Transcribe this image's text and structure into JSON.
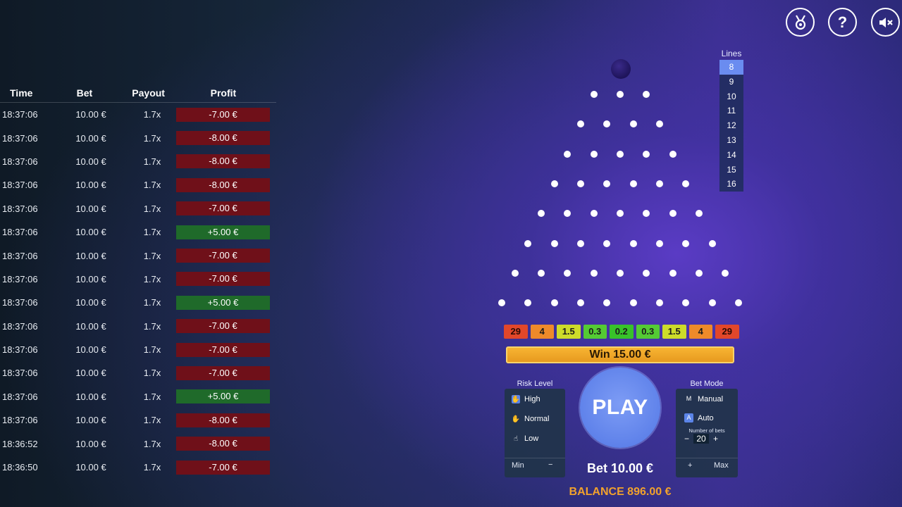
{
  "history": {
    "headers": {
      "time": "Time",
      "bet": "Bet",
      "payout": "Payout",
      "profit": "Profit"
    },
    "rows": [
      {
        "time": "18:37:06",
        "bet": "10.00 €",
        "payout": "1.7x",
        "profit": "-7.00 €",
        "type": "loss"
      },
      {
        "time": "18:37:06",
        "bet": "10.00 €",
        "payout": "1.7x",
        "profit": "-8.00 €",
        "type": "loss"
      },
      {
        "time": "18:37:06",
        "bet": "10.00 €",
        "payout": "1.7x",
        "profit": "-8.00 €",
        "type": "loss"
      },
      {
        "time": "18:37:06",
        "bet": "10.00 €",
        "payout": "1.7x",
        "profit": "-8.00 €",
        "type": "loss"
      },
      {
        "time": "18:37:06",
        "bet": "10.00 €",
        "payout": "1.7x",
        "profit": "-7.00 €",
        "type": "loss"
      },
      {
        "time": "18:37:06",
        "bet": "10.00 €",
        "payout": "1.7x",
        "profit": "+5.00 €",
        "type": "win"
      },
      {
        "time": "18:37:06",
        "bet": "10.00 €",
        "payout": "1.7x",
        "profit": "-7.00 €",
        "type": "loss"
      },
      {
        "time": "18:37:06",
        "bet": "10.00 €",
        "payout": "1.7x",
        "profit": "-7.00 €",
        "type": "loss"
      },
      {
        "time": "18:37:06",
        "bet": "10.00 €",
        "payout": "1.7x",
        "profit": "+5.00 €",
        "type": "win"
      },
      {
        "time": "18:37:06",
        "bet": "10.00 €",
        "payout": "1.7x",
        "profit": "-7.00 €",
        "type": "loss"
      },
      {
        "time": "18:37:06",
        "bet": "10.00 €",
        "payout": "1.7x",
        "profit": "-7.00 €",
        "type": "loss"
      },
      {
        "time": "18:37:06",
        "bet": "10.00 €",
        "payout": "1.7x",
        "profit": "-7.00 €",
        "type": "loss"
      },
      {
        "time": "18:37:06",
        "bet": "10.00 €",
        "payout": "1.7x",
        "profit": "+5.00 €",
        "type": "win"
      },
      {
        "time": "18:37:06",
        "bet": "10.00 €",
        "payout": "1.7x",
        "profit": "-8.00 €",
        "type": "loss"
      },
      {
        "time": "18:36:52",
        "bet": "10.00 €",
        "payout": "1.7x",
        "profit": "-8.00 €",
        "type": "loss"
      },
      {
        "time": "18:36:50",
        "bet": "10.00 €",
        "payout": "1.7x",
        "profit": "-7.00 €",
        "type": "loss"
      }
    ]
  },
  "top_buttons": [
    {
      "name": "achievements-button",
      "icon": "medal-icon"
    },
    {
      "name": "help-button",
      "icon": "question-icon",
      "glyph": "?"
    },
    {
      "name": "mute-button",
      "icon": "speaker-muted-icon"
    }
  ],
  "lines": {
    "title": "Lines",
    "options": [
      "8",
      "9",
      "10",
      "11",
      "12",
      "13",
      "14",
      "15",
      "16"
    ],
    "selected": "8"
  },
  "board": {
    "rows": 8,
    "buckets": [
      "29",
      "4",
      "1.5",
      "0.3",
      "0.2",
      "0.3",
      "1.5",
      "4",
      "29"
    ]
  },
  "win_banner": "Win 15.00 €",
  "risk": {
    "title": "Risk Level",
    "options": [
      "High",
      "Normal",
      "Low"
    ],
    "selected": "High",
    "min_label": "Min",
    "minus_label": "−"
  },
  "play_label": "PLAY",
  "bet_label": "Bet 10.00 €",
  "balance_label": "BALANCE 896.00 €",
  "bet_mode": {
    "title": "Bet Mode",
    "manual_key": "M",
    "manual_label": "Manual",
    "auto_key": "A",
    "auto_label": "Auto",
    "selected": "Auto",
    "number_of_bets_label": "Number of bets",
    "number_of_bets": "20",
    "dec_label": "−",
    "inc_label": "+",
    "plus_label": "+",
    "max_label": "Max"
  },
  "colors": {
    "accent": "#5f82ea",
    "loss": "#6f1019",
    "win": "#1f6a2a",
    "balance": "#f2a22c",
    "banner": "#f7b432"
  }
}
